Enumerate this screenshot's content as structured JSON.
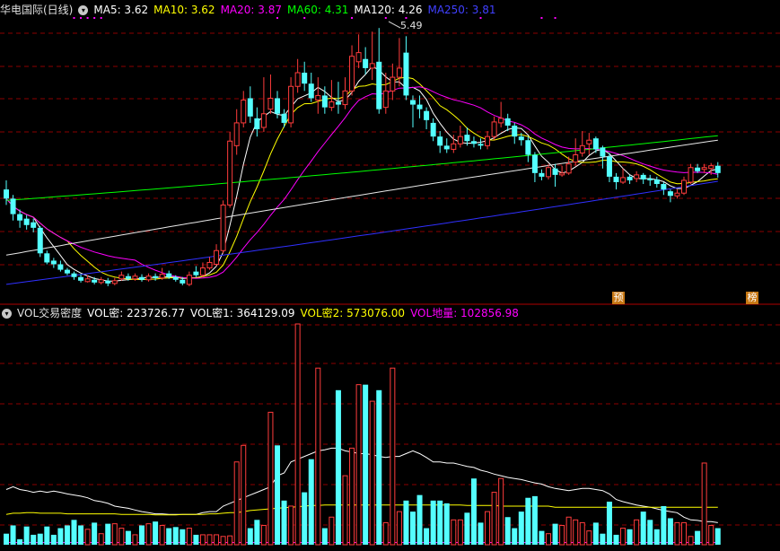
{
  "price_header": {
    "title": "华电国际(日线)",
    "collapse_icon": "chevron-down-icon",
    "indicators": [
      {
        "label": "MA5: 3.62",
        "color": "#ffffff"
      },
      {
        "label": "MA10: 3.62",
        "color": "#ffff00"
      },
      {
        "label": "MA20: 3.87",
        "color": "#ff00ff"
      },
      {
        "label": "MA60: 4.31",
        "color": "#00ff00"
      },
      {
        "label": "MA120: 4.26",
        "color": "#ffffff"
      },
      {
        "label": "MA250: 3.81",
        "color": "#4040ff"
      }
    ]
  },
  "volume_header": {
    "title": "VOL交易密度",
    "collapse_icon": "chevron-down-icon",
    "indicators": [
      {
        "label": "VOL密: 223726.77",
        "color": "#ffffff"
      },
      {
        "label": "VOL密1: 364129.09",
        "color": "#ffffff"
      },
      {
        "label": "VOL密2: 573076.00",
        "color": "#ffff00"
      },
      {
        "label": "VOL地量: 102856.98",
        "color": "#ff00ff"
      }
    ]
  },
  "high_label": "5.49",
  "event_tags": [
    "预",
    "榜"
  ],
  "colors": {
    "up": "#ff3c3c",
    "down": "#54ffff",
    "grid": "#8b0000",
    "background": "#000000"
  },
  "chart_data": {
    "type": "candlestick",
    "candles": [
      [
        3.72,
        3.62,
        3.82,
        3.55
      ],
      [
        3.62,
        3.45,
        3.66,
        3.38
      ],
      [
        3.45,
        3.38,
        3.5,
        3.3
      ],
      [
        3.4,
        3.33,
        3.44,
        3.28
      ],
      [
        3.36,
        3.3,
        3.4,
        3.25
      ],
      [
        3.3,
        3.02,
        3.32,
        2.98
      ],
      [
        3.02,
        2.92,
        3.05,
        2.9
      ],
      [
        2.94,
        2.9,
        2.97,
        2.86
      ],
      [
        2.9,
        2.84,
        2.94,
        2.82
      ],
      [
        2.84,
        2.8,
        2.86,
        2.78
      ],
      [
        2.8,
        2.76,
        2.82,
        2.73
      ],
      [
        2.76,
        2.72,
        2.79,
        2.7
      ],
      [
        2.71,
        2.74,
        2.78,
        2.7
      ],
      [
        2.73,
        2.7,
        2.76,
        2.68
      ],
      [
        2.7,
        2.73,
        2.76,
        2.68
      ],
      [
        2.72,
        2.69,
        2.75,
        2.66
      ],
      [
        2.69,
        2.72,
        2.75,
        2.67
      ],
      [
        2.74,
        2.78,
        2.82,
        2.72
      ],
      [
        2.77,
        2.74,
        2.8,
        2.72
      ],
      [
        2.74,
        2.77,
        2.8,
        2.72
      ],
      [
        2.76,
        2.73,
        2.79,
        2.71
      ],
      [
        2.73,
        2.77,
        2.8,
        2.71
      ],
      [
        2.77,
        2.75,
        2.8,
        2.72
      ],
      [
        2.75,
        2.79,
        2.86,
        2.73
      ],
      [
        2.8,
        2.76,
        2.83,
        2.74
      ],
      [
        2.76,
        2.73,
        2.78,
        2.71
      ],
      [
        2.73,
        2.69,
        2.76,
        2.67
      ],
      [
        2.68,
        2.78,
        2.82,
        2.66
      ],
      [
        2.82,
        2.78,
        2.88,
        2.76
      ],
      [
        2.78,
        2.86,
        2.92,
        2.76
      ],
      [
        2.86,
        2.92,
        2.98,
        2.84
      ],
      [
        2.9,
        3.05,
        3.12,
        2.88
      ],
      [
        3.05,
        3.55,
        3.6,
        3.02
      ],
      [
        3.55,
        4.25,
        4.35,
        3.52
      ],
      [
        4.2,
        4.45,
        4.6,
        4.1
      ],
      [
        4.45,
        4.7,
        4.8,
        4.4
      ],
      [
        4.72,
        4.52,
        4.85,
        4.45
      ],
      [
        4.5,
        4.38,
        4.62,
        4.3
      ],
      [
        4.4,
        4.55,
        4.95,
        4.35
      ],
      [
        4.6,
        4.72,
        4.98,
        4.55
      ],
      [
        4.72,
        4.55,
        4.8,
        4.5
      ],
      [
        4.55,
        4.45,
        4.6,
        4.4
      ],
      [
        4.45,
        4.85,
        4.95,
        4.4
      ],
      [
        4.85,
        5.0,
        5.15,
        4.78
      ],
      [
        5.0,
        4.88,
        5.12,
        4.8
      ],
      [
        4.88,
        4.72,
        5.0,
        4.68
      ],
      [
        4.7,
        4.75,
        4.95,
        4.55
      ],
      [
        4.75,
        4.62,
        4.85,
        4.55
      ],
      [
        4.62,
        4.68,
        4.92,
        4.58
      ],
      [
        4.68,
        4.65,
        4.9,
        4.55
      ],
      [
        4.65,
        4.8,
        4.95,
        4.6
      ],
      [
        4.8,
        5.18,
        5.3,
        4.75
      ],
      [
        5.12,
        5.22,
        5.42,
        5.05
      ],
      [
        5.15,
        5.05,
        5.28,
        4.98
      ],
      [
        5.05,
        5.1,
        5.45,
        4.92
      ],
      [
        5.12,
        4.6,
        5.49,
        4.55
      ],
      [
        4.62,
        4.8,
        5.0,
        4.55
      ],
      [
        4.8,
        4.95,
        5.1,
        4.7
      ],
      [
        4.95,
        5.05,
        5.38,
        4.85
      ],
      [
        5.22,
        4.75,
        5.4,
        4.7
      ],
      [
        4.7,
        4.65,
        4.75,
        4.4
      ],
      [
        4.65,
        4.6,
        4.75,
        4.5
      ],
      [
        4.58,
        4.48,
        4.62,
        4.38
      ],
      [
        4.45,
        4.3,
        4.5,
        4.25
      ],
      [
        4.3,
        4.2,
        4.36,
        4.12
      ],
      [
        4.2,
        4.16,
        4.28,
        4.12
      ],
      [
        4.16,
        4.22,
        4.32,
        4.12
      ],
      [
        4.22,
        4.3,
        4.42,
        4.18
      ],
      [
        4.32,
        4.25,
        4.4,
        4.2
      ],
      [
        4.25,
        4.22,
        4.3,
        4.18
      ],
      [
        4.22,
        4.2,
        4.28,
        4.16
      ],
      [
        4.2,
        4.3,
        4.36,
        4.16
      ],
      [
        4.3,
        4.46,
        4.52,
        4.26
      ],
      [
        4.45,
        4.5,
        4.68,
        4.4
      ],
      [
        4.5,
        4.42,
        4.55,
        4.36
      ],
      [
        4.42,
        4.3,
        4.45,
        4.22
      ],
      [
        4.3,
        4.26,
        4.34,
        4.2
      ],
      [
        4.26,
        4.1,
        4.3,
        4.02
      ],
      [
        4.1,
        3.9,
        4.13,
        3.8
      ],
      [
        3.9,
        3.86,
        3.94,
        3.82
      ],
      [
        3.86,
        3.96,
        4.0,
        3.83
      ],
      [
        3.95,
        3.88,
        4.0,
        3.75
      ],
      [
        3.88,
        3.9,
        3.98,
        3.86
      ],
      [
        3.9,
        4.0,
        4.08,
        3.88
      ],
      [
        4.02,
        4.1,
        4.28,
        3.98
      ],
      [
        4.12,
        4.2,
        4.36,
        4.08
      ],
      [
        4.22,
        4.26,
        4.34,
        4.1
      ],
      [
        4.28,
        4.16,
        4.3,
        4.12
      ],
      [
        4.18,
        4.08,
        4.2,
        3.95
      ],
      [
        4.08,
        3.86,
        4.12,
        3.8
      ],
      [
        3.86,
        3.8,
        3.9,
        3.72
      ],
      [
        3.8,
        3.85,
        3.95,
        3.78
      ],
      [
        3.86,
        3.82,
        3.88,
        3.78
      ],
      [
        3.84,
        3.88,
        3.92,
        3.8
      ],
      [
        3.88,
        3.83,
        3.9,
        3.78
      ],
      [
        3.84,
        3.82,
        3.88,
        3.76
      ],
      [
        3.83,
        3.78,
        3.86,
        3.74
      ],
      [
        3.78,
        3.72,
        3.8,
        3.66
      ],
      [
        3.7,
        3.65,
        3.72,
        3.58
      ],
      [
        3.65,
        3.68,
        3.72,
        3.62
      ],
      [
        3.68,
        3.82,
        3.86,
        3.66
      ],
      [
        3.8,
        3.96,
        4.0,
        3.78
      ],
      [
        3.96,
        3.92,
        4.0,
        3.9
      ],
      [
        3.94,
        3.96,
        4.0,
        3.9
      ],
      [
        3.95,
        3.98,
        4.01,
        3.88
      ],
      [
        3.98,
        3.9,
        4.02,
        3.85
      ]
    ],
    "volume": [
      20,
      35,
      10,
      33,
      18,
      20,
      33,
      18,
      30,
      35,
      45,
      35,
      28,
      40,
      20,
      38,
      38,
      30,
      25,
      18,
      35,
      38,
      42,
      35,
      30,
      32,
      28,
      30,
      18,
      18,
      18,
      18,
      15,
      16,
      150,
      180,
      30,
      45,
      35,
      240,
      180,
      80,
      70,
      400,
      95,
      155,
      320,
      30,
      50,
      280,
      125,
      175,
      290,
      290,
      260,
      280,
      40,
      320,
      60,
      80,
      60,
      90,
      30,
      80,
      80,
      75,
      45,
      45,
      58,
      120,
      40,
      60,
      95,
      120,
      50,
      30,
      60,
      85,
      88,
      25,
      20,
      38,
      35,
      50,
      45,
      40,
      25,
      40,
      20,
      78,
      18,
      30,
      28,
      45,
      60,
      45,
      28,
      70,
      48,
      40,
      40,
      15,
      25,
      148,
      35,
      30
    ],
    "volume_lines": [
      {
        "name": "VOL密",
        "color": "#ffffff",
        "values": [
          100,
          105,
          100,
          98,
          95,
          97,
          95,
          97,
          95,
          92,
          90,
          88,
          85,
          80,
          78,
          75,
          70,
          68,
          66,
          63,
          60,
          58,
          56,
          56,
          55,
          55,
          55,
          55,
          55,
          58,
          60,
          60,
          70,
          75,
          80,
          85,
          90,
          95,
          100,
          105,
          125,
          130,
          150,
          155,
          160,
          165,
          170,
          172,
          175,
          175,
          170,
          168,
          165,
          165,
          163,
          160,
          158,
          160,
          160,
          165,
          170,
          165,
          158,
          150,
          150,
          148,
          148,
          145,
          142,
          140,
          135,
          132,
          128,
          125,
          122,
          120,
          118,
          115,
          112,
          110,
          105,
          102,
          100,
          98,
          100,
          102,
          102,
          100,
          98,
          92,
          82,
          78,
          75,
          72,
          70,
          68,
          65,
          62,
          60,
          58,
          50,
          45,
          44,
          42,
          42,
          40
        ]
      },
      {
        "name": "VOL密2",
        "color": "#ffff00",
        "values": [
          55,
          57,
          57,
          58,
          58,
          57,
          57,
          57,
          57,
          56,
          56,
          56,
          56,
          56,
          56,
          56,
          56,
          55,
          55,
          55,
          55,
          55,
          54,
          54,
          54,
          54,
          55,
          55,
          55,
          55,
          56,
          56,
          57,
          58,
          58,
          60,
          62,
          63,
          64,
          65,
          66,
          67,
          68,
          69,
          70,
          71,
          71,
          72,
          72,
          72,
          72,
          72,
          72,
          72,
          72,
          72,
          72,
          72,
          72,
          72,
          72,
          72,
          72,
          72,
          72,
          72,
          72,
          72,
          71,
          71,
          71,
          71,
          71,
          70,
          70,
          70,
          70,
          70,
          70,
          70,
          70,
          68,
          68,
          68,
          68,
          68,
          68,
          68,
          68,
          68,
          68,
          68,
          68,
          68,
          68,
          68,
          68,
          68,
          68,
          68,
          68,
          68,
          68,
          68,
          68,
          68
        ]
      },
      {
        "name": "VOL地量",
        "color": "#ff00ff",
        "values": [
          4,
          4,
          4,
          4,
          4,
          4,
          4,
          4,
          4,
          4,
          4,
          4,
          4,
          4,
          4,
          4,
          4,
          4,
          4,
          4,
          4,
          4,
          4,
          4,
          4,
          4,
          4,
          4,
          4,
          4,
          4,
          4,
          4,
          4,
          4,
          4,
          4,
          4,
          4,
          4,
          4,
          4,
          4,
          4,
          4,
          4,
          4,
          4,
          4,
          4,
          4,
          4,
          4,
          4,
          4,
          4,
          4,
          4,
          4,
          4,
          4,
          4,
          4,
          4,
          4,
          4,
          4,
          4,
          4,
          4,
          4,
          4,
          4,
          4,
          4,
          4,
          4,
          4,
          4,
          4,
          4,
          4,
          4,
          4,
          4,
          4,
          4,
          4,
          4,
          4,
          4,
          4,
          4,
          4,
          4,
          4,
          4,
          4,
          4,
          4,
          4,
          4,
          4,
          4,
          4,
          4
        ]
      }
    ]
  }
}
